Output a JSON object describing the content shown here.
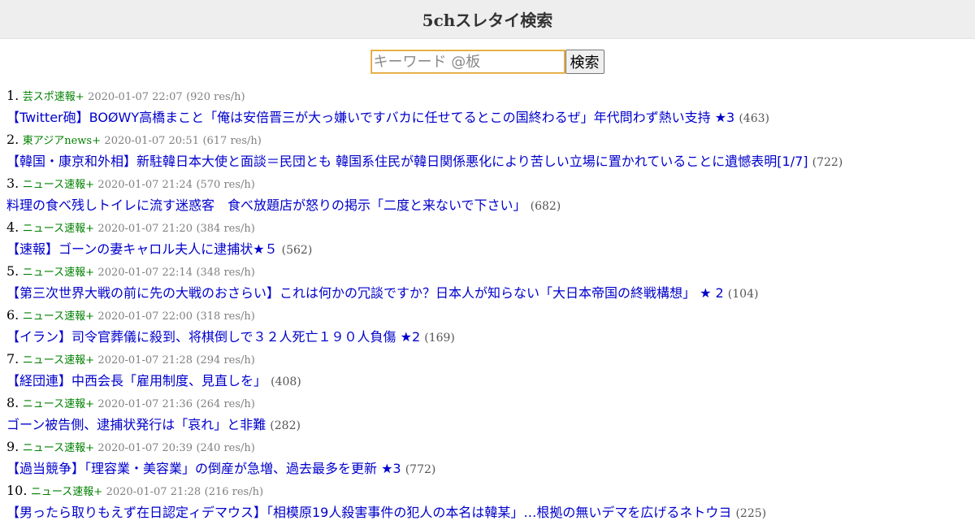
{
  "header": {
    "title": "5chスレタイ検索"
  },
  "search": {
    "placeholder": "キーワード @板",
    "value": "",
    "button_label": "検索"
  },
  "entries": [
    {
      "rank": "1.",
      "board": "芸スポ速報+",
      "date": "2020-01-07 22:07",
      "rate": "(920 res/h)",
      "title": "【Twitter砲】BOØWY高橋まこと「俺は安倍晋三が大っ嫌いですバカに任せてるとこの国終わるぜ」年代問わず熱い支持 ★3",
      "count": "(463)"
    },
    {
      "rank": "2.",
      "board": "東アジアnews+",
      "date": "2020-01-07 20:51",
      "rate": "(617 res/h)",
      "title": "【韓国・康京和外相】新駐韓日本大使と面談＝民団とも 韓国系住民が韓日関係悪化により苦しい立場に置かれていることに遺憾表明[1/7]",
      "count": "(722)"
    },
    {
      "rank": "3.",
      "board": "ニュース速報+",
      "date": "2020-01-07 21:24",
      "rate": "(570 res/h)",
      "title": "料理の食べ残しトイレに流す迷惑客　食べ放題店が怒りの掲示「二度と来ないで下さい」",
      "count": "(682)"
    },
    {
      "rank": "4.",
      "board": "ニュース速報+",
      "date": "2020-01-07 21:20",
      "rate": "(384 res/h)",
      "title": "【速報】ゴーンの妻キャロル夫人に逮捕状★５",
      "count": "(562)"
    },
    {
      "rank": "5.",
      "board": "ニュース速報+",
      "date": "2020-01-07 22:14",
      "rate": "(348 res/h)",
      "title": "【第三次世界大戦の前に先の大戦のおさらい】これは何かの冗談ですか？日本人が知らない「大日本帝国の終戦構想」 ★ 2",
      "count": "(104)"
    },
    {
      "rank": "6.",
      "board": "ニュース速報+",
      "date": "2020-01-07 22:00",
      "rate": "(318 res/h)",
      "title": "【イラン】司令官葬儀に殺到、将棋倒しで３２人死亡１９０人負傷 ★2",
      "count": "(169)"
    },
    {
      "rank": "7.",
      "board": "ニュース速報+",
      "date": "2020-01-07 21:28",
      "rate": "(294 res/h)",
      "title": "【経団連】中西会長「雇用制度、見直しを」",
      "count": "(408)"
    },
    {
      "rank": "8.",
      "board": "ニュース速報+",
      "date": "2020-01-07 21:36",
      "rate": "(264 res/h)",
      "title": "ゴーン被告側、逮捕状発行は「哀れ」と非難",
      "count": "(282)"
    },
    {
      "rank": "9.",
      "board": "ニュース速報+",
      "date": "2020-01-07 20:39",
      "rate": "(240 res/h)",
      "title": "【過当競争】「理容業・美容業」の倒産が急増、過去最多を更新 ★3",
      "count": "(772)"
    },
    {
      "rank": "10.",
      "board": "ニュース速報+",
      "date": "2020-01-07 21:28",
      "rate": "(216 res/h)",
      "title": "【男ったら取りもえず在日認定ィデマウス】「相模原19人殺害事件の犯人の本名は韓某」…根拠の無いデマを広げるネトウヨ",
      "count": "(225)"
    }
  ]
}
